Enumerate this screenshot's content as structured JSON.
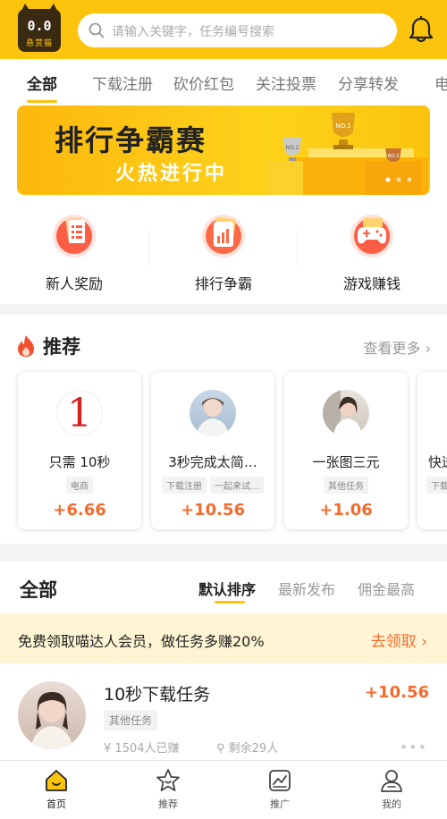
{
  "header": {
    "logo_face": "0.0",
    "logo_name": "悬赏猫",
    "search_placeholder": "请输入关键字，任务编号搜索"
  },
  "tabs": [
    {
      "label": "全部",
      "active": true
    },
    {
      "label": "下载注册",
      "active": false
    },
    {
      "label": "砍价红包",
      "active": false
    },
    {
      "label": "关注投票",
      "active": false
    },
    {
      "label": "分享转发",
      "active": false
    },
    {
      "label": "电",
      "active": false
    }
  ],
  "banner": {
    "title": "排行争霸赛",
    "subtitle": "火热进行中",
    "trophy_labels": [
      "NO.1",
      "NO.2",
      "NO.3"
    ]
  },
  "quick_entries": [
    {
      "label": "新人奖励",
      "icon": "document-list-icon"
    },
    {
      "label": "排行争霸",
      "icon": "bar-chart-icon"
    },
    {
      "label": "游戏赚钱",
      "icon": "gamepad-icon"
    }
  ],
  "recommend": {
    "title": "推荐",
    "more": "查看更多",
    "cards": [
      {
        "title": "只需 10秒",
        "tags": [
          "电商"
        ],
        "reward": "+6.66",
        "avatar_text": "1"
      },
      {
        "title": "3秒完成太简…",
        "tags": [
          "下载注册",
          "一起来试…"
        ],
        "reward": "+10.56",
        "avatar_text": ""
      },
      {
        "title": "一张图三元",
        "tags": [
          "其他任务"
        ],
        "reward": "+1.06",
        "avatar_text": ""
      },
      {
        "title": "快送",
        "tags": [
          "下载"
        ],
        "reward": "",
        "avatar_text": ""
      }
    ]
  },
  "all_section": {
    "title": "全部",
    "sorts": [
      {
        "label": "默认排序",
        "active": true
      },
      {
        "label": "最新发布",
        "active": false
      },
      {
        "label": "佣金最高",
        "active": false
      }
    ]
  },
  "promo": {
    "text": "免费领取喵达人会员，做任务多赚20%",
    "link": "去领取"
  },
  "task": {
    "title": "10秒下载任务",
    "reward": "+10.56",
    "tag": "其他任务",
    "earned": "1504人已赚",
    "remaining": "剩余29人",
    "more": "•••"
  },
  "bottom_nav": [
    {
      "label": "首页",
      "icon": "home-icon",
      "active": true
    },
    {
      "label": "推荐",
      "icon": "star-icon",
      "active": false
    },
    {
      "label": "推广",
      "icon": "trend-icon",
      "active": false
    },
    {
      "label": "我的",
      "icon": "user-icon",
      "active": false
    }
  ],
  "colors": {
    "brand_yellow": "#fcc40d",
    "reward_orange": "#f46b2c"
  }
}
